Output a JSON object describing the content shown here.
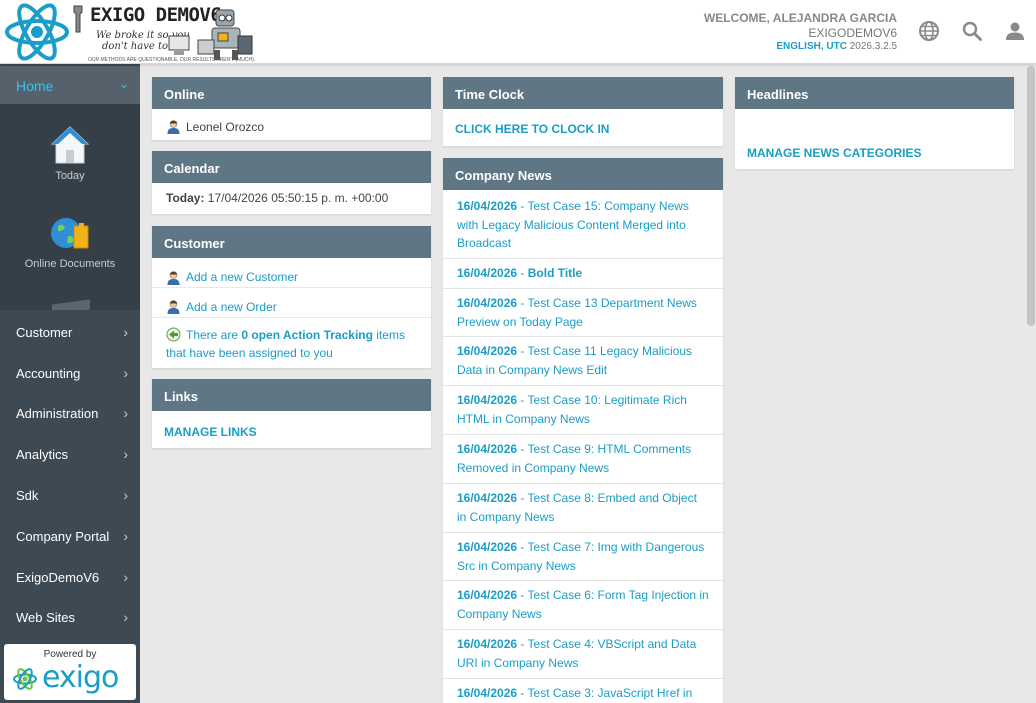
{
  "header": {
    "logo_title": "EXIGO DEMOV6",
    "logo_tagline_1": "We broke it so you",
    "logo_tagline_2": "don't have to.",
    "logo_tiny": "OUR METHODS ARE QUESTIONABLE. OUR RESULTS AREN'T (MUCH).",
    "welcome": "WELCOME, ALEJANDRA GARCIA",
    "company": "EXIGODEMOV6",
    "language": "ENGLISH, UTC",
    "version": "2026.3.2.5",
    "icons": [
      "globe-icon",
      "search-icon",
      "user-icon"
    ]
  },
  "sidebar": {
    "home_label": "Home",
    "tiles": [
      {
        "label": "Today",
        "icon": "house-icon"
      },
      {
        "label": "Online Documents",
        "icon": "globe-folder-icon"
      }
    ],
    "items": [
      {
        "label": "Customer"
      },
      {
        "label": "Accounting"
      },
      {
        "label": "Administration"
      },
      {
        "label": "Analytics"
      },
      {
        "label": "Sdk"
      },
      {
        "label": "Company Portal"
      },
      {
        "label": "ExigoDemoV6"
      },
      {
        "label": "Web Sites"
      }
    ],
    "powered_by": "Powered by",
    "brand": "exigo"
  },
  "online": {
    "title": "Online",
    "user": "Leonel Orozco"
  },
  "calendar": {
    "title": "Calendar",
    "today_label": "Today:",
    "today_value": "17/04/2026 05:50:15 p. m. +00:00"
  },
  "customer": {
    "title": "Customer",
    "add_customer": "Add a new Customer",
    "add_order": "Add a new Order",
    "tracking_pre": "There are ",
    "tracking_link": "0 open Action Tracking",
    "tracking_post": " items that have been assigned to you"
  },
  "links": {
    "title": "Links",
    "manage": "MANAGE LINKS"
  },
  "timeclock": {
    "title": "Time Clock",
    "action": "CLICK HERE TO CLOCK IN"
  },
  "news": {
    "title": "Company News",
    "separator": " - ",
    "items": [
      {
        "date": "16/04/2026",
        "title": "Test Case 15: Company News with Legacy Malicious Content Merged into Broadcast"
      },
      {
        "date": "16/04/2026",
        "title": "Bold Title"
      },
      {
        "date": "16/04/2026",
        "title": "Test Case 13 Department News Preview on Today Page"
      },
      {
        "date": "16/04/2026",
        "title": "Test Case 11 Legacy Malicious Data in Company News Edit"
      },
      {
        "date": "16/04/2026",
        "title": "Test Case 10: Legitimate Rich HTML in Company News"
      },
      {
        "date": "16/04/2026",
        "title": "Test Case 9: HTML Comments Removed in Company News"
      },
      {
        "date": "16/04/2026",
        "title": "Test Case 8: Embed and Object in Company News"
      },
      {
        "date": "16/04/2026",
        "title": "Test Case 7: Img with Dangerous Src in Company News"
      },
      {
        "date": "16/04/2026",
        "title": "Test Case 6: Form Tag Injection in Company News"
      },
      {
        "date": "16/04/2026",
        "title": "Test Case 4: VBScript and Data URI in Company News"
      },
      {
        "date": "16/04/2026",
        "title": "Test Case 3: JavaScript Href in"
      }
    ]
  },
  "headlines": {
    "title": "Headlines",
    "manage": "MANAGE NEWS CATEGORIES"
  },
  "colors": {
    "accent": "#1a9dc6",
    "panel_header": "#5f7684",
    "sidebar": "#3e4a53"
  }
}
